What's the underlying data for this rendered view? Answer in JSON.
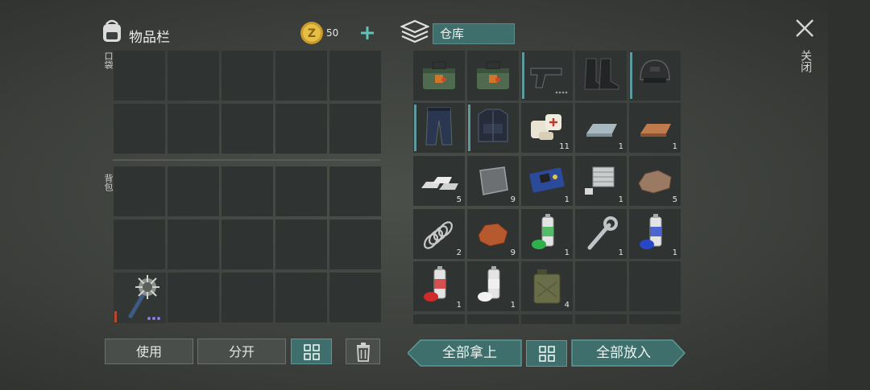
{
  "inventory": {
    "title": "物品栏",
    "coins": "50",
    "pocket_label": "口袋",
    "backpack_label": "背包"
  },
  "storage": {
    "title": "仓库",
    "items": [
      {
        "name": "explosive-crate",
        "count": ""
      },
      {
        "name": "explosive-crate",
        "count": ""
      },
      {
        "name": "pistol",
        "count": ""
      },
      {
        "name": "boots",
        "count": ""
      },
      {
        "name": "helmet",
        "count": ""
      },
      {
        "name": "tactical-pants",
        "count": ""
      },
      {
        "name": "tactical-vest",
        "count": ""
      },
      {
        "name": "bandage",
        "count": "11"
      },
      {
        "name": "iron-ingot",
        "count": "1"
      },
      {
        "name": "copper-ingot",
        "count": "1"
      },
      {
        "name": "silver-bars",
        "count": "5"
      },
      {
        "name": "metal-plate",
        "count": "9"
      },
      {
        "name": "circuit-board",
        "count": "1"
      },
      {
        "name": "engine-block",
        "count": "1"
      },
      {
        "name": "ore-rock",
        "count": "5"
      },
      {
        "name": "spring",
        "count": "2"
      },
      {
        "name": "copper-ore",
        "count": "9"
      },
      {
        "name": "green-spray-paint",
        "count": "1"
      },
      {
        "name": "wrench",
        "count": "1"
      },
      {
        "name": "blue-spray-paint",
        "count": "1"
      },
      {
        "name": "red-spray-paint",
        "count": "1"
      },
      {
        "name": "white-spray-paint",
        "count": "1"
      },
      {
        "name": "jerrycan",
        "count": "4"
      }
    ]
  },
  "buttons": {
    "use": "使用",
    "split": "分开",
    "take_all": "全部拿上",
    "put_all": "全部放入",
    "close": "关闭"
  },
  "colors": {
    "accent": "#3e6f6c",
    "accent_light": "#5c9a96",
    "slot": "#2f3331"
  }
}
